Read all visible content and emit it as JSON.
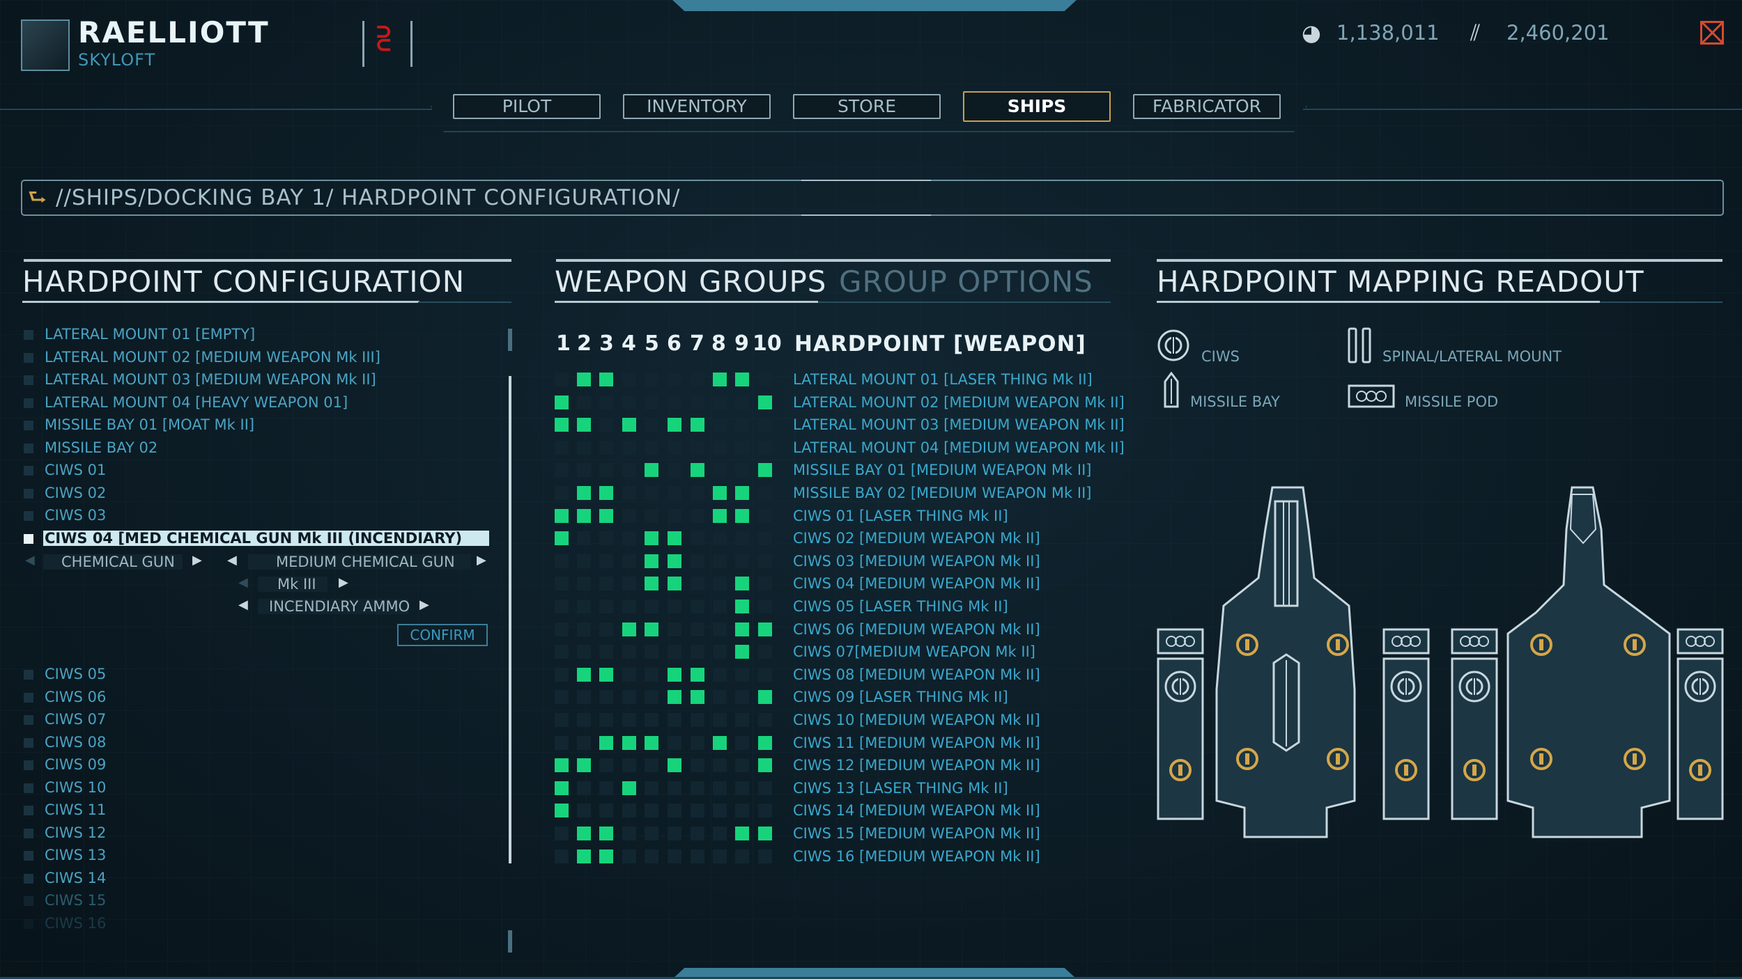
{
  "header": {
    "player_name": "RAELLIOTT",
    "ship_name": "SKYLOFT",
    "rank_icon": "chevron-rank-icon",
    "currency_a": "1,138,011",
    "currency_b": "2,460,201"
  },
  "tabs": [
    {
      "label": "PILOT",
      "active": false
    },
    {
      "label": "INVENTORY",
      "active": false
    },
    {
      "label": "STORE",
      "active": false
    },
    {
      "label": "SHIPS",
      "active": true
    },
    {
      "label": "FABRICATOR",
      "active": false
    }
  ],
  "breadcrumb": "//SHIPS/DOCKING BAY 1/ HARDPOINT CONFIGURATION/",
  "hardpoint_config": {
    "title": "HARDPOINT CONFIGURATION",
    "items_top": [
      "LATERAL MOUNT 01 [EMPTY]",
      "LATERAL MOUNT 02 [MEDIUM WEAPON Mk III]",
      "LATERAL MOUNT 03 [MEDIUM WEAPON Mk II]",
      "LATERAL MOUNT 04 [HEAVY WEAPON 01]",
      "MISSILE BAY 01 [MOAT Mk II]",
      "MISSILE BAY 02",
      "CIWS 01",
      "CIWS 02",
      "CIWS 03"
    ],
    "selected": "CIWS 04 [MED CHEMICAL GUN Mk III (INCENDIARY)",
    "options": {
      "type": "CHEMICAL GUN",
      "subtype": "MEDIUM CHEMICAL GUN",
      "mark": "Mk III",
      "ammo": "INCENDIARY AMMO",
      "confirm": "CONFIRM"
    },
    "items_bottom": [
      "CIWS 05",
      "CIWS 06",
      "CIWS 07",
      "CIWS 08",
      "CIWS 09",
      "CIWS 10",
      "CIWS 11",
      "CIWS 12",
      "CIWS 13",
      "CIWS 14",
      "CIWS 15",
      "CIWS 16"
    ]
  },
  "weapon_groups": {
    "tab_active": "WEAPON GROUPS",
    "tab_inactive": "GROUP OPTIONS",
    "columns": [
      "1",
      "2",
      "3",
      "4",
      "5",
      "6",
      "7",
      "8",
      "9",
      "10"
    ],
    "header": "HARDPOINT [WEAPON]",
    "rows": [
      {
        "label": "LATERAL MOUNT 01 [LASER THING Mk II]",
        "on": [
          2,
          3,
          8,
          9
        ]
      },
      {
        "label": "LATERAL MOUNT 02 [MEDIUM WEAPON Mk II]",
        "on": [
          1,
          10
        ]
      },
      {
        "label": "LATERAL MOUNT 03 [MEDIUM WEAPON Mk II]",
        "on": [
          1,
          2,
          4,
          6,
          7
        ]
      },
      {
        "label": "LATERAL MOUNT 04 [MEDIUM WEAPON Mk II]",
        "on": []
      },
      {
        "label": "MISSILE BAY 01 [MEDIUM WEAPON Mk II]",
        "on": [
          5,
          7,
          10
        ]
      },
      {
        "label": "MISSILE BAY 02 [MEDIUM WEAPON Mk II]",
        "on": [
          2,
          3,
          8,
          9
        ]
      },
      {
        "label": "CIWS 01 [LASER THING Mk II]",
        "on": [
          1,
          2,
          3,
          8,
          9
        ]
      },
      {
        "label": "CIWS 02 [MEDIUM WEAPON Mk II]",
        "on": [
          1,
          5,
          6
        ]
      },
      {
        "label": "CIWS 03 [MEDIUM WEAPON Mk II]",
        "on": [
          5,
          6
        ]
      },
      {
        "label": "CIWS 04 [MEDIUM WEAPON Mk II]",
        "on": [
          5,
          6,
          9
        ]
      },
      {
        "label": "CIWS 05 [LASER THING Mk II]",
        "on": [
          9
        ]
      },
      {
        "label": "CIWS 06 [MEDIUM WEAPON Mk II]",
        "on": [
          4,
          5,
          9,
          10
        ]
      },
      {
        "label": "CIWS 07[MEDIUM WEAPON Mk II]",
        "on": [
          9
        ]
      },
      {
        "label": "CIWS 08 [MEDIUM WEAPON Mk II]",
        "on": [
          2,
          3,
          6,
          7
        ]
      },
      {
        "label": "CIWS 09 [LASER THING Mk II]",
        "on": [
          6,
          7,
          10
        ]
      },
      {
        "label": "CIWS 10 [MEDIUM WEAPON Mk II]",
        "on": []
      },
      {
        "label": "CIWS 11 [MEDIUM WEAPON Mk II]",
        "on": [
          3,
          4,
          5,
          8,
          10
        ]
      },
      {
        "label": "CIWS 12 [MEDIUM WEAPON Mk II]",
        "on": [
          1,
          2,
          6,
          10
        ]
      },
      {
        "label": "CIWS 13 [LASER THING Mk II]",
        "on": [
          1,
          4
        ]
      },
      {
        "label": "CIWS 14 [MEDIUM WEAPON Mk II]",
        "on": [
          1
        ]
      },
      {
        "label": "CIWS 15 [MEDIUM WEAPON Mk II]",
        "on": [
          2,
          3,
          9,
          10
        ]
      },
      {
        "label": "CIWS 16 [MEDIUM WEAPON Mk II]",
        "on": [
          2,
          3
        ]
      }
    ]
  },
  "readout": {
    "title": "HARDPOINT MAPPING READOUT",
    "legend": [
      {
        "label": "CIWS",
        "icon": "ciws-icon"
      },
      {
        "label": "SPINAL/LATERAL MOUNT",
        "icon": "spinal-mount-icon"
      },
      {
        "label": "MISSILE BAY",
        "icon": "missile-bay-icon"
      },
      {
        "label": "MISSILE POD",
        "icon": "missile-pod-icon"
      }
    ]
  },
  "colors": {
    "accent_green": "#17d47c",
    "accent_gold": "#c9a050",
    "text_blue": "#4ba3c3",
    "close_red": "#d74a30"
  }
}
